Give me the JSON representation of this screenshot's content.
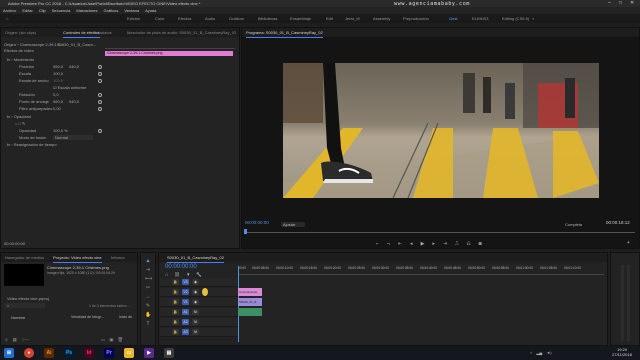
{
  "window": {
    "title": "Adobe Premiere Pro CC 2018 - C:\\Usuarios\\Jose\\Portol\\Escritorio\\VIDEO EFECTO CINE\\Video efecto cine *"
  },
  "watermark": "www.agenciamababy.com",
  "menu": [
    "Archivo",
    "Editar",
    "Clip",
    "Secuencia",
    "Marcadores",
    "Gráficos",
    "Ventana",
    "Ayuda"
  ],
  "workspace": {
    "items": [
      "Edición",
      "Color",
      "Efectos",
      "Audio",
      "Gráficos",
      "Bibliotecas",
      "Ensamblaje",
      "Edit",
      "Jerar_III",
      "Assembly",
      "Preproducción",
      "Gest",
      "ELENIS3",
      "Editing (CS5.5)"
    ],
    "active_index": 11
  },
  "effects_panel": {
    "tabs": [
      "Origen: (sin clips)",
      "Controles de efectos",
      "Metadatos",
      "Mezclador de pista de audio: S0030_01_B_CasmineyRay_02"
    ],
    "source_label": "Origen * Cinemascope 2-39:1 C...",
    "sequence_label": "S0030_01_B_Casm...",
    "video_effects": "Efectos de vídeo",
    "section_motion": "Movimiento",
    "position_label": "Posición",
    "position_x": "960,0",
    "position_y": "540,0",
    "scale_label": "Escala",
    "scale_value": "100,0",
    "scale_width_label": "Escala de ancho",
    "scale_width_value": "100,0",
    "uniform_label": "Escala uniforme",
    "rotation_label": "Rotación",
    "rotation_value": "0,0",
    "anchor_label": "Punto de anclaje",
    "anchor_x": "960,0",
    "anchor_y": "540,0",
    "antiflicker_label": "Filtro antiparpadeo",
    "antiflicker_value": "0,00",
    "opacity_section": "Opacidad",
    "opacity_label": "Opacidad",
    "opacity_value": "100,0 %",
    "blend_label": "Modo de fusión",
    "blend_value": "Normal",
    "time_remap": "Reasignación de tiempo",
    "clip_bar": "Cinemascope 2-39-1 Cristmes.png",
    "timecode": "00:00:00:00"
  },
  "program": {
    "tab": "Programa: S0030_01_B_CasmineyRay_02",
    "timecode_left": "00:00:00:00",
    "fit": "Ajustar",
    "quality": "Completa",
    "timecode_right": "00:00:18:12"
  },
  "project": {
    "tabs": [
      "Navegador de medios",
      "Proyecto: Video efecto cine",
      "Informa"
    ],
    "item_name": "Cinemascope 2-39-1 Cristmes.png",
    "item_info": "Imagen fija, 1920 x 1080 (1,0) / 00:00:04:29",
    "project_file": "Video efecto cine.prproj",
    "selection": "1 de 3 elementos selecc...",
    "column_name": "Nombre",
    "column_speed": "Velocidad de fotogr...",
    "column_start": "Inicio de"
  },
  "timeline": {
    "tab": "S0030_01_B_CasmineyRay_02",
    "timecode": "00:00:00:00",
    "ruler": [
      "00:00",
      "00:00:05:00",
      "00:00:10:00",
      "00:00:15:00",
      "00:00:20:00",
      "00:00:25:00",
      "00:00:30:00",
      "00:00:35:00",
      "00:00:40:00",
      "00:00:45:00",
      "00:00:50:00",
      "00:00:55:00",
      "00:01:00:00",
      "00:01:05:00",
      "00:01:10:00"
    ],
    "video_tracks": [
      "V3",
      "V2",
      "V1"
    ],
    "audio_tracks": [
      "A1",
      "A2",
      "A3"
    ],
    "clip_v2": "Cinemascope",
    "clip_v1": "S0030_01_B",
    "clip_a1": "",
    "accent_color": "#c63ee0"
  },
  "taskbar": {
    "time": "19:20",
    "date": "27/11/2018",
    "apps": [
      "start-icon",
      "chrome-icon",
      "illustrator-icon",
      "photoshop-icon",
      "indesign-icon",
      "premiere-icon",
      "explorer-icon",
      "media-icon",
      "files-icon"
    ]
  }
}
